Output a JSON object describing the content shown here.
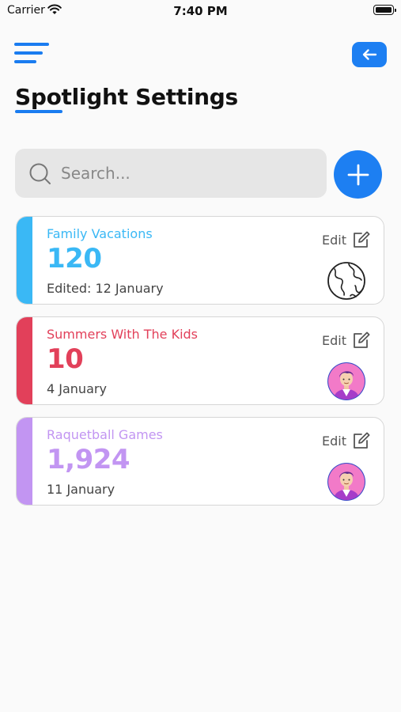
{
  "status_bar": {
    "carrier": "Carrier",
    "time": "7:40 PM"
  },
  "header": {
    "title": "Spotlight Settings"
  },
  "search": {
    "placeholder": "Search..."
  },
  "cards": [
    {
      "title": "Family Vacations",
      "count": "120",
      "date": "Edited: 12 January",
      "edit_label": "Edit",
      "color": "#3ab8f5",
      "thumb_icon": "globe-icon"
    },
    {
      "title": "Summers With The Kids",
      "count": "10",
      "date": "4 January",
      "edit_label": "Edit",
      "color": "#e2405a",
      "thumb_icon": "avatar-icon"
    },
    {
      "title": "Raquetball Games",
      "count": "1,924",
      "date": "11 January",
      "edit_label": "Edit",
      "color": "#c295f2",
      "thumb_icon": "avatar-icon"
    }
  ],
  "colors": {
    "accent": "#1d7ff2",
    "search_bg": "#e6e6e6"
  }
}
